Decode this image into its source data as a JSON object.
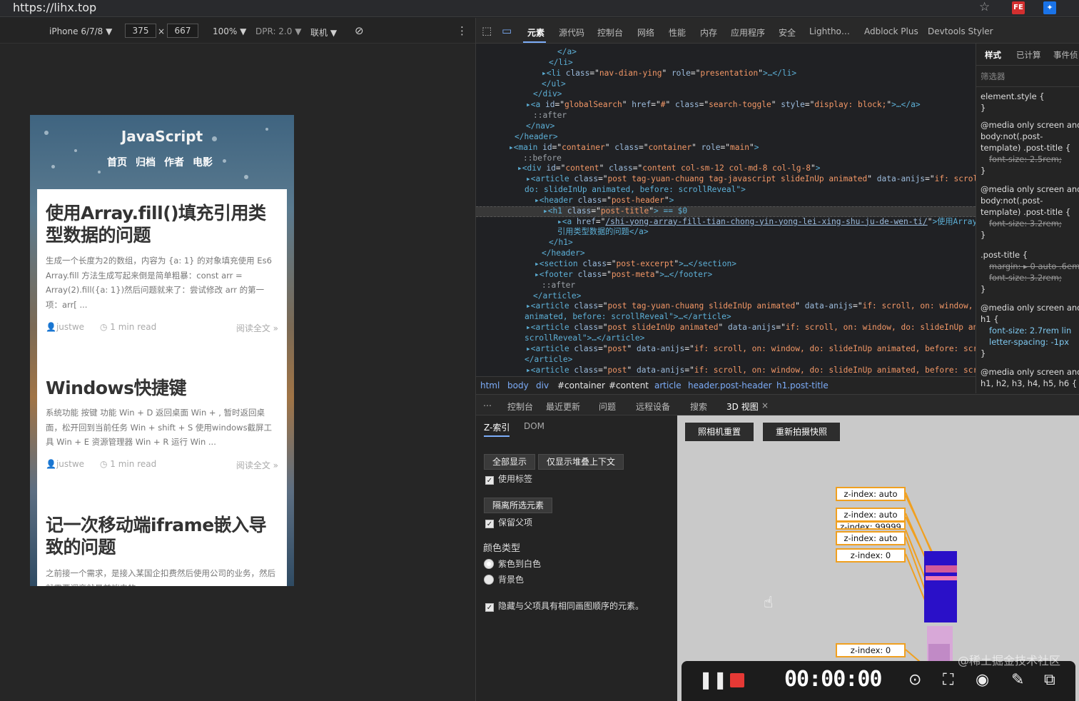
{
  "browser": {
    "url": "https://lihx.top",
    "ext1": "FE"
  },
  "device_toolbar": {
    "device": "iPhone 6/7/8 ▼",
    "width": "375",
    "times": "×",
    "height": "667",
    "zoom": "100% ▼",
    "dpr": "DPR: 2.0 ▼",
    "network": "联机 ▼"
  },
  "page": {
    "brand": "JavaScript",
    "nav": [
      "首页",
      "归档",
      "作者",
      "电影"
    ],
    "articles": [
      {
        "title": "使用Array.fill()填充引用类型数据的问题",
        "excerpt": "生成一个长度为2的数组，内容为 {a: 1} 的对象填充使用 Es6 Array.fill 方法生成写起来倒是简单粗暴：const arr = Array(2).fill({a: 1})然后问题就来了：尝试修改 arr 的第一项：arr[ ...",
        "author": "justwe",
        "read": "1 min read",
        "more": "阅读全文 »"
      },
      {
        "title": "Windows快捷键",
        "excerpt": "系统功能 按键 功能 Win + D 返回桌面 Win + , 暂时返回桌面，松开回到当前任务 Win + shift + S 使用windows截屏工具 Win + E 资源管理器 Win + R 运行 Win ...",
        "author": "justwe",
        "read": "1 min read",
        "more": "阅读全文 »"
      },
      {
        "title": "记一次移动端iframe嵌入导致的问题",
        "excerpt": "之前接一个需求，是接入某国企扣费然后使用公司的业务，然后就需要调商就是前端来的"
      }
    ]
  },
  "devtools": {
    "tabs": [
      "元素",
      "源代码",
      "控制台",
      "网络",
      "性能",
      "内存",
      "应用程序",
      "安全",
      "Lightho…",
      "Adblock Plus",
      "Devtools Styler"
    ],
    "dom_lines": [
      {
        "indent": 780,
        "html": "</a>"
      },
      {
        "indent": 768,
        "html": "</li>"
      },
      {
        "indent": 758,
        "tag": "li",
        "attrs": [
          [
            "class",
            "nav-dian-ying"
          ],
          [
            "role",
            "presentation"
          ]
        ],
        "tail": ">…</li>"
      },
      {
        "indent": 758,
        "html": "</ul>"
      },
      {
        "indent": 746,
        "html": "</div>"
      },
      {
        "indent": 736,
        "tag": "a",
        "attrs": [
          [
            "id",
            "globalSearch"
          ],
          [
            "href",
            "#"
          ],
          [
            "class",
            "search-toggle"
          ],
          [
            "style",
            "display: block;"
          ]
        ],
        "tail": ">…</a>"
      },
      {
        "indent": 746,
        "pseudo": "::after"
      },
      {
        "indent": 736,
        "html": "</nav>"
      },
      {
        "indent": 720,
        "html": "</header>"
      },
      {
        "indent": 712,
        "tag": "main",
        "attrs": [
          [
            "id",
            "container"
          ],
          [
            "class",
            "container"
          ],
          [
            "role",
            "main"
          ]
        ],
        "tail": ">"
      },
      {
        "indent": 732,
        "pseudo": "::before"
      },
      {
        "indent": 724,
        "tag": "div",
        "attrs": [
          [
            "id",
            "content"
          ],
          [
            "class",
            "content col-sm-12 col-md-8 col-lg-8"
          ]
        ],
        "tail": ">"
      },
      {
        "indent": 736,
        "tag": "article",
        "attrs": [
          [
            "class",
            "post tag-yuan-chuang tag-javascript slideInUp animated"
          ],
          [
            "data-anijs",
            "if: scroll, on: window,"
          ]
        ],
        "tail": ""
      },
      {
        "indent": 734,
        "text": "do: slideInUp animated, before: scrollReveal\">"
      },
      {
        "indent": 748,
        "tag": "header",
        "attrs": [
          [
            "class",
            "post-header"
          ]
        ],
        "tail": ">"
      },
      {
        "indent": 760,
        "tag": "h1",
        "attrs": [
          [
            "class",
            "post-title"
          ]
        ],
        "tail": "> == $0"
      },
      {
        "indent": 780,
        "tag": "a",
        "attrs": [
          [
            "href",
            "/shi-yong-array-fill-tian-chong-yin-yong-lei-xing-shu-ju-de-wen-ti/"
          ]
        ],
        "tail": ">使用Array.fill()填充"
      },
      {
        "indent": 780,
        "text": "引用类型数据的问题</a>"
      },
      {
        "indent": 768,
        "html": "</h1>"
      },
      {
        "indent": 758,
        "html": "</header>"
      },
      {
        "indent": 748,
        "tag": "section",
        "attrs": [
          [
            "class",
            "post-excerpt"
          ]
        ],
        "tail": ">…</section>"
      },
      {
        "indent": 748,
        "tag": "footer",
        "attrs": [
          [
            "class",
            "post-meta"
          ]
        ],
        "tail": ">…</footer>"
      },
      {
        "indent": 758,
        "pseudo": "::after"
      },
      {
        "indent": 746,
        "html": "</article>"
      },
      {
        "indent": 736,
        "tag": "article",
        "attrs": [
          [
            "class",
            "post tag-yuan-chuang slideInUp animated"
          ],
          [
            "data-anijs",
            "if: scroll, on: window, do: slideInUp"
          ]
        ],
        "tail": ""
      },
      {
        "indent": 734,
        "text": "animated, before: scrollReveal\">…</article>"
      },
      {
        "indent": 736,
        "tag": "article",
        "attrs": [
          [
            "class",
            "post slideInUp animated"
          ],
          [
            "data-anijs",
            "if: scroll, on: window, do: slideInUp animated, before:"
          ]
        ],
        "tail": ""
      },
      {
        "indent": 734,
        "text": "scrollReveal\">…</article>"
      },
      {
        "indent": 736,
        "tag": "article",
        "attrs": [
          [
            "class",
            "post"
          ],
          [
            "data-anijs",
            "if: scroll, on: window, do: slideInUp animated, before: scrollReveal"
          ]
        ],
        "tail": ">…"
      },
      {
        "indent": 734,
        "html": "</article>"
      },
      {
        "indent": 736,
        "tag": "article",
        "attrs": [
          [
            "class",
            "post"
          ],
          [
            "data-anijs",
            "if: scroll, on: window, do: slideInUp animated, before: scrollReveal"
          ]
        ],
        "tail": ">…"
      }
    ],
    "styles_tabs": [
      "样式",
      "已计算",
      "事件侦"
    ],
    "filter": "筛选器",
    "styles_lines": [
      {
        "t": "element.style {",
        "c": ""
      },
      {
        "t": "}",
        "c": ""
      },
      {
        "t": "@media only screen and",
        "c": ""
      },
      {
        "t": "body:not(.post-",
        "c": ""
      },
      {
        "t": "template) .post-title {",
        "c": ""
      },
      {
        "t": "font-size: 2.5rem;",
        "c": "strike"
      },
      {
        "t": "}",
        "c": ""
      },
      {
        "t": "@media only screen and",
        "c": ""
      },
      {
        "t": "body:not(.post-",
        "c": ""
      },
      {
        "t": "template) .post-title {",
        "c": ""
      },
      {
        "t": "font-size: 3.2rem;",
        "c": "strike"
      },
      {
        "t": "}",
        "c": ""
      },
      {
        "t": ".post-title {",
        "c": ""
      },
      {
        "t": "margin: ▸ 0 auto .6em",
        "c": "strike"
      },
      {
        "t": "font-size: 3.2rem;",
        "c": "strike"
      },
      {
        "t": "}",
        "c": ""
      },
      {
        "t": "@media only screen and",
        "c": ""
      },
      {
        "t": "h1 {",
        "c": ""
      },
      {
        "t": "font-size: 2.7rem lin",
        "c": "prop"
      },
      {
        "t": "letter-spacing: -1px",
        "c": "prop"
      },
      {
        "t": "}",
        "c": ""
      },
      {
        "t": "@media only screen and",
        "c": ""
      },
      {
        "t": "h1, h2, h3, h4, h5, h6 {",
        "c": ""
      }
    ],
    "breadcrumbs": [
      "html",
      "body",
      "div",
      "#container",
      "#content",
      "article",
      "header.post-header",
      "h1.post-title"
    ],
    "drawer_tabs": [
      "控制台",
      "最近更新",
      "问题",
      "远程设备",
      "搜索",
      "3D 视图"
    ],
    "panel3d": {
      "subtabs": [
        "Z-索引",
        "DOM"
      ],
      "show_all": "全部显示",
      "only_stack": "仅显示堆叠上下文",
      "use_labels": "使用标签",
      "isolate": "隔离所选元素",
      "keep_parents": "保留父项",
      "color_type": "颜色类型",
      "purple_white": "紫色到白色",
      "background": "背景色",
      "hide_same": "隐藏与父项具有相同画图顺序的元素。",
      "reset_camera": "照相机重置",
      "retake": "重新拍摄快照",
      "labels": [
        "z-index: auto",
        "z-index: auto",
        "z-index: 99999",
        "z-index: auto",
        "z-index: 0",
        "z-index: 0"
      ]
    },
    "recorder": {
      "timer": "00:00:00"
    }
  },
  "watermark": "@稀土掘金技术社区"
}
